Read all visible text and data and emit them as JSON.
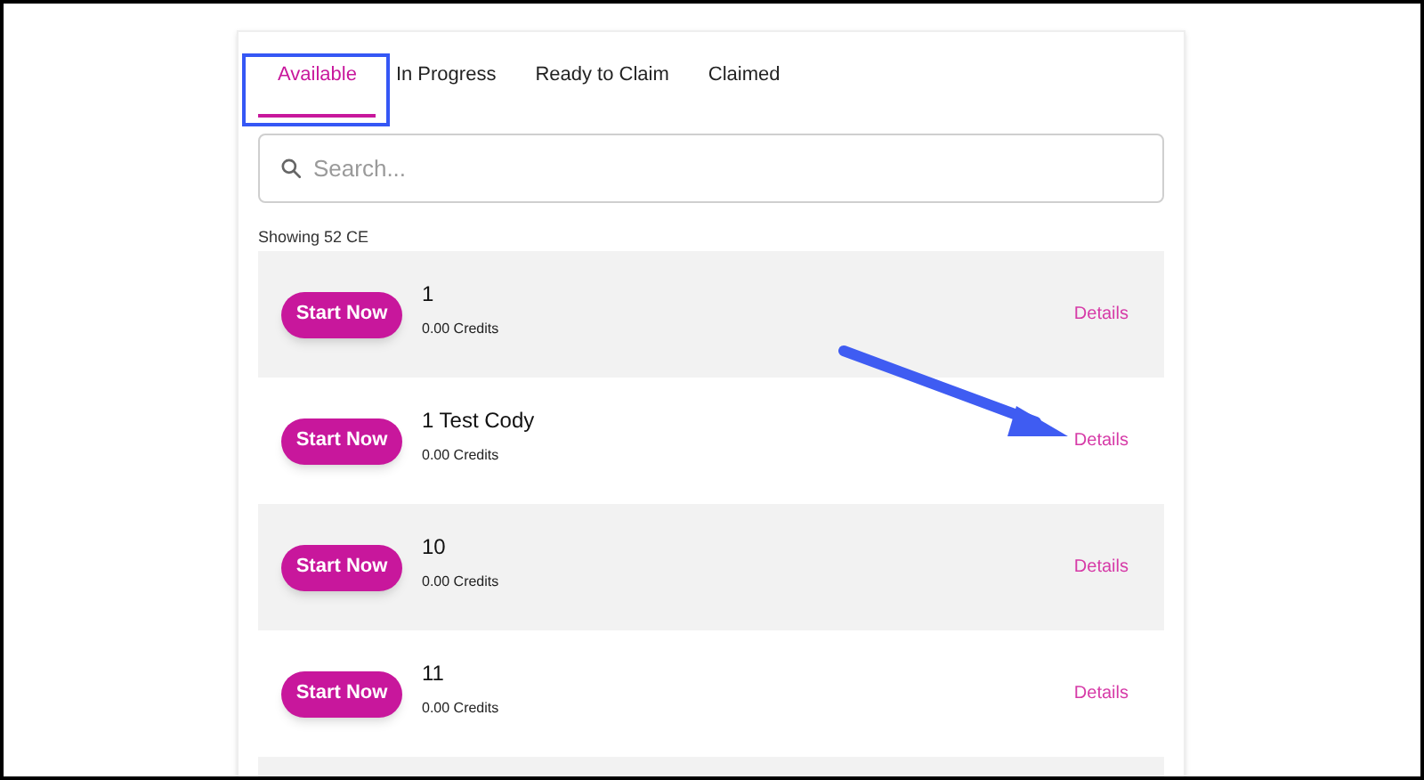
{
  "tabs": [
    {
      "label": "Available",
      "selected": true
    },
    {
      "label": "In Progress",
      "selected": false
    },
    {
      "label": "Ready to Claim",
      "selected": false
    },
    {
      "label": "Claimed",
      "selected": false
    }
  ],
  "search": {
    "placeholder": "Search..."
  },
  "count": "Showing 52 CE",
  "items": [
    {
      "title": "1",
      "credits": "0.00 Credits",
      "button": "Start Now",
      "link": "Details"
    },
    {
      "title": "1 Test Cody",
      "credits": "0.00 Credits",
      "button": "Start Now",
      "link": "Details"
    },
    {
      "title": "10",
      "credits": "0.00 Credits",
      "button": "Start Now",
      "link": "Details"
    },
    {
      "title": "11",
      "credits": "0.00 Credits",
      "button": "Start Now",
      "link": "Details"
    }
  ]
}
